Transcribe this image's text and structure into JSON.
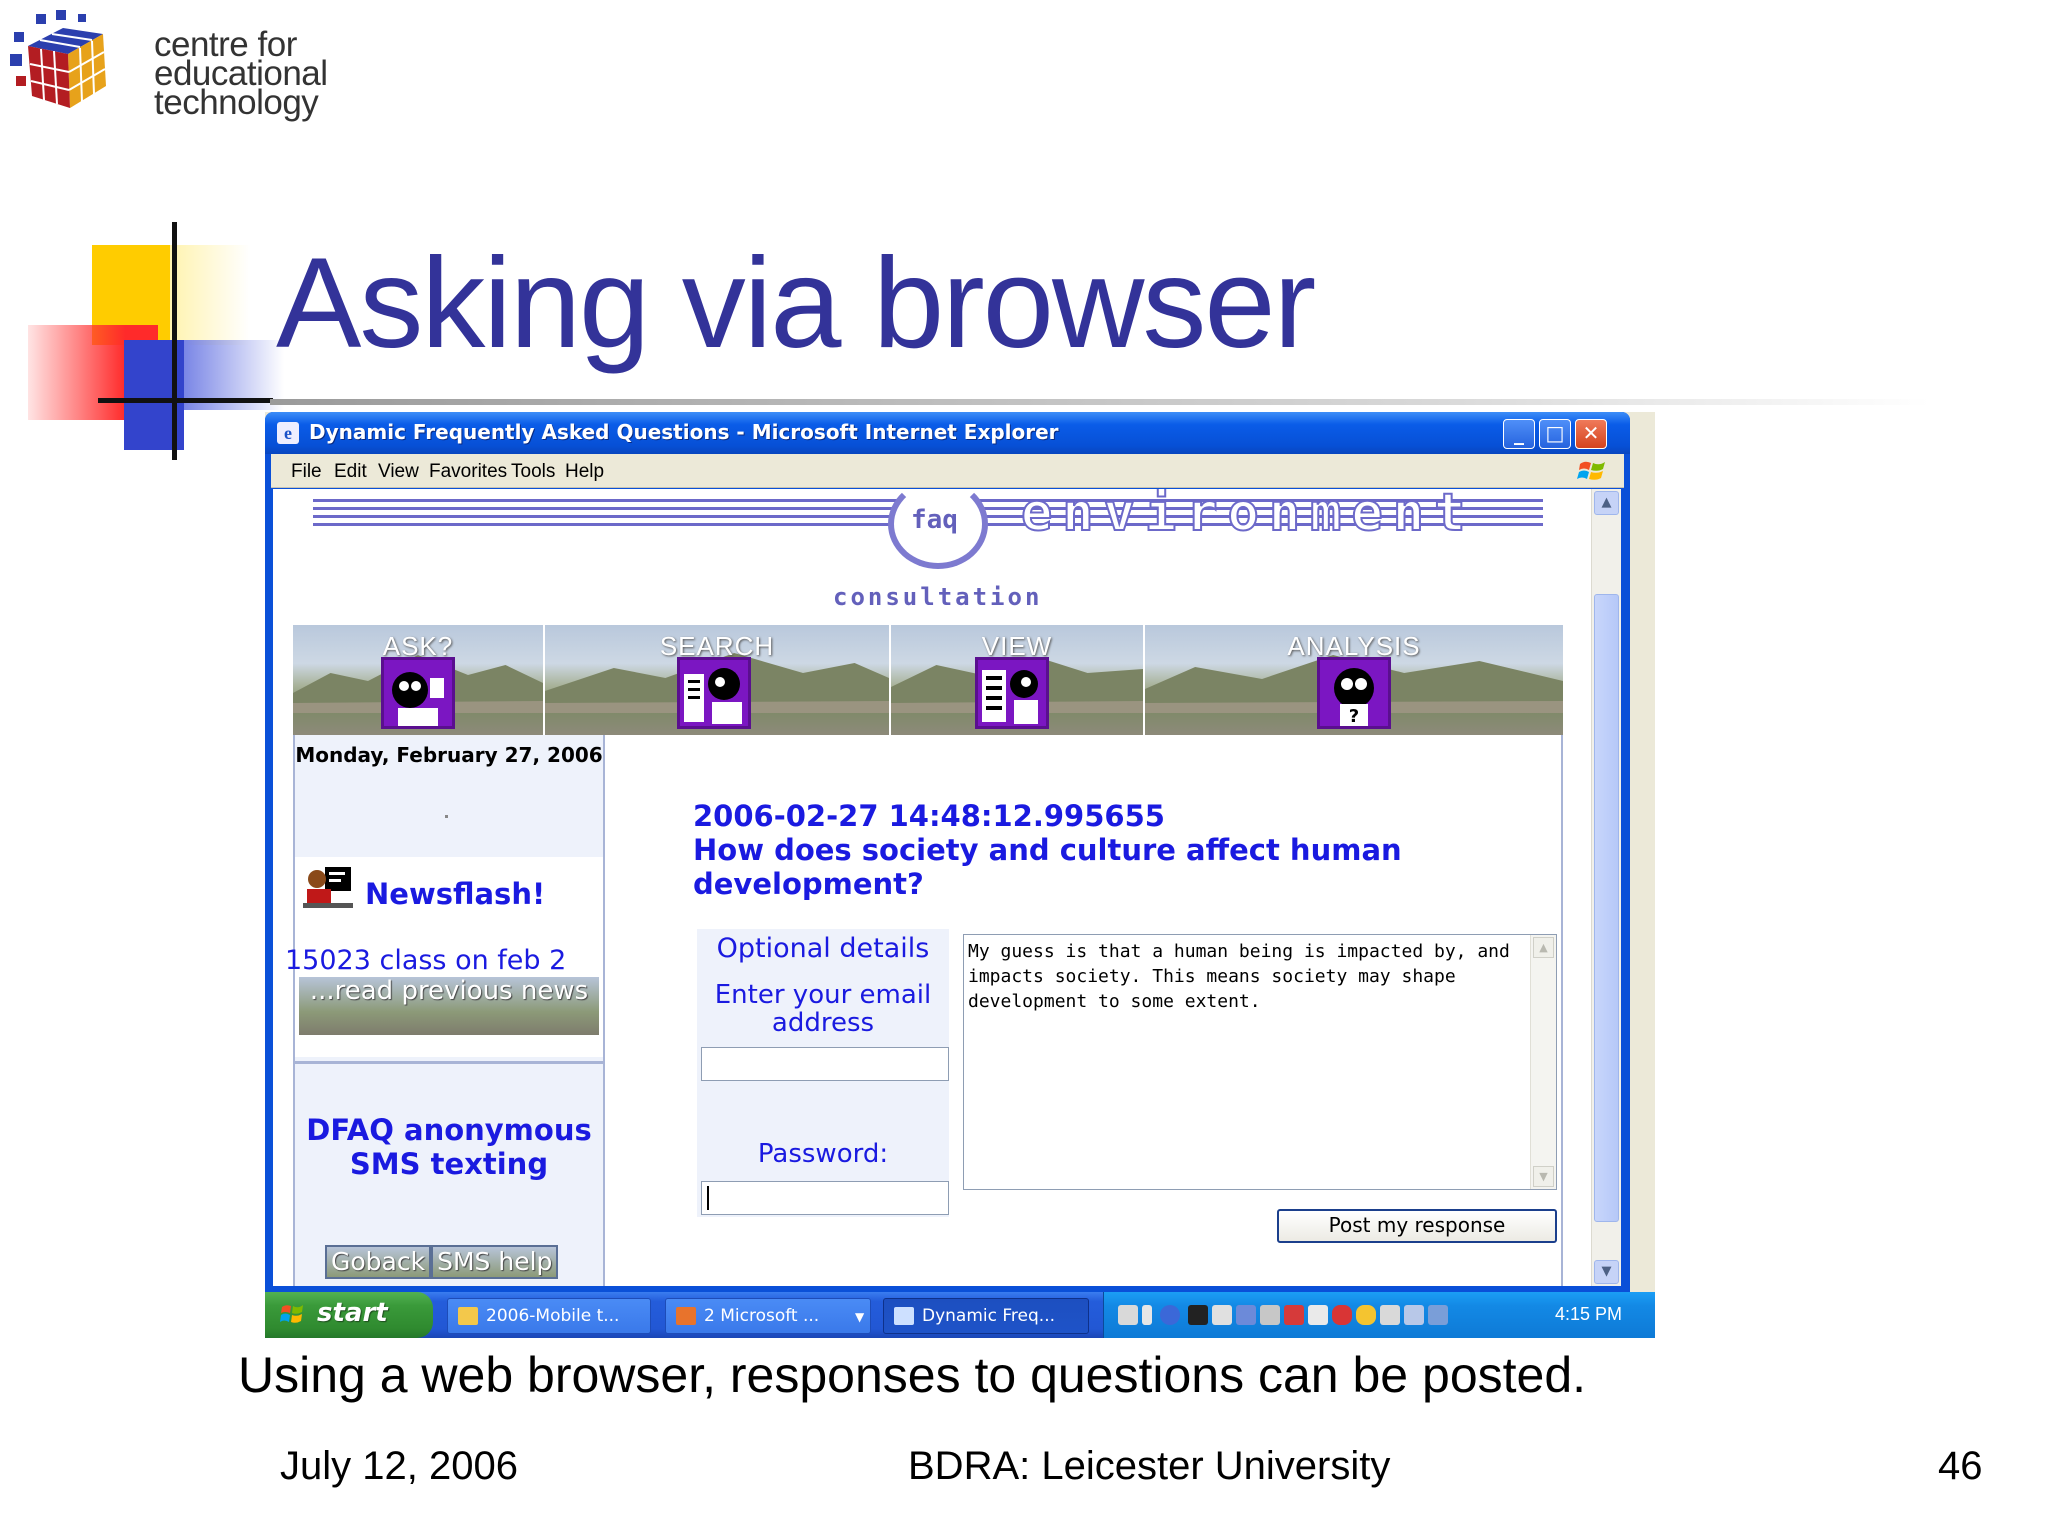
{
  "slide": {
    "logo_lines": [
      "centre for",
      "educational",
      "technology"
    ],
    "title": "Asking via browser",
    "caption": "Using a web browser, responses to questions can be posted.",
    "footer_date": "July 12, 2006",
    "footer_center": "BDRA: Leicester University",
    "page_number": "46"
  },
  "colors": {
    "title": "#333399",
    "link_blue": "#1a1ae0",
    "header_purple": "#6360bb",
    "xp_blue": "#0a50d8",
    "xp_green": "#3a9a3a"
  },
  "window": {
    "title": "Dynamic Frequently Asked Questions - Microsoft Internet Explorer",
    "menu": [
      "File",
      "Edit",
      "View",
      "Favorites",
      "Tools",
      "Help"
    ],
    "controls": [
      "minimize-icon",
      "maximize-icon",
      "close-icon"
    ]
  },
  "page": {
    "header": {
      "faq": "faq",
      "environment": "environment",
      "consultation": "consultation"
    },
    "nav": [
      "ASK?",
      "SEARCH",
      "VIEW",
      "ANALYSIS"
    ],
    "left": {
      "date": "Monday, February 27, 2006",
      "newsflash": "Newsflash!",
      "news_item": "15023 class on feb 2",
      "read_previous": "...read previous news",
      "sms_title": "DFAQ anonymous SMS texting",
      "goback": "Goback",
      "sms_help": "SMS help"
    },
    "question": {
      "timestamp": "2006-02-27 14:48:12.995655",
      "text": "How does society and culture affect human development?"
    },
    "form": {
      "optional_details": "Optional details",
      "email_label": "Enter your email address",
      "email_value": "",
      "password_label": "Password:",
      "password_value": "",
      "response": "My guess is that a human being is impacted by, and impacts society. This means society may shape development to some extent.",
      "post_button": "Post my response"
    }
  },
  "taskbar": {
    "start": "start",
    "tasks": [
      "2006-Mobile t...",
      "2 Microsoft ...",
      "Dynamic Freq..."
    ],
    "clock": "4:15 PM"
  }
}
